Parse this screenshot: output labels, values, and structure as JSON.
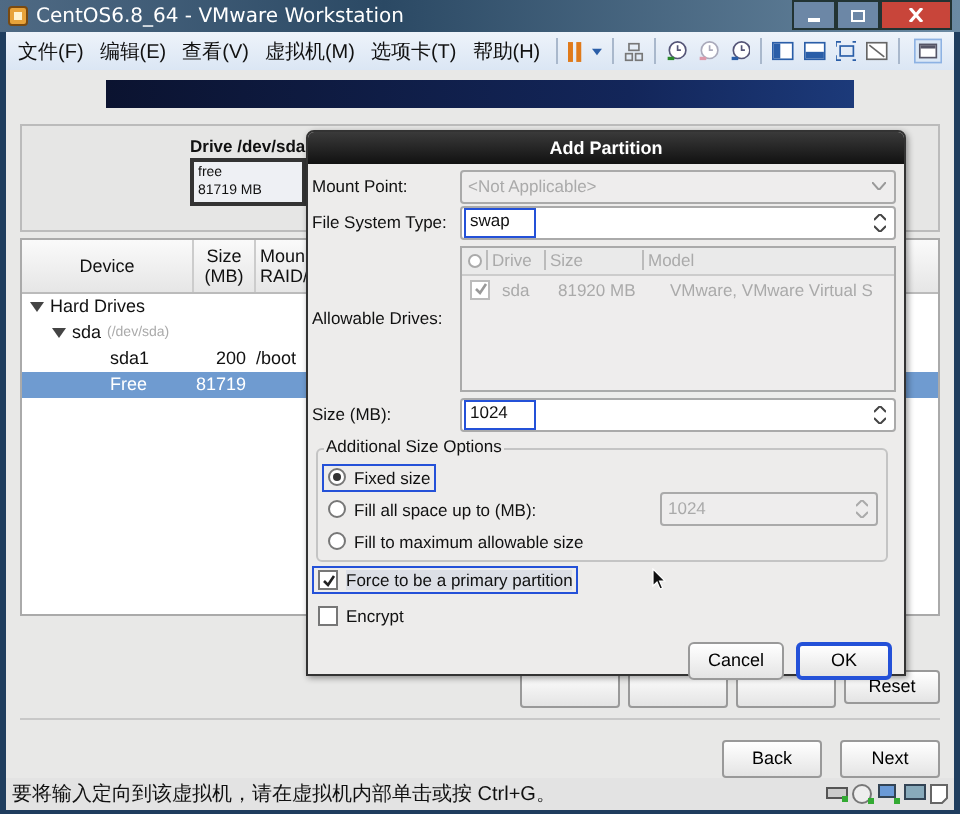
{
  "window": {
    "title": "CentOS6.8_64 - VMware Workstation"
  },
  "menu": [
    "文件(F)",
    "编辑(E)",
    "查看(V)",
    "虚拟机(M)",
    "选项卡(T)",
    "帮助(H)"
  ],
  "drive": {
    "title": "Drive /dev/sda",
    "segment_label": "free",
    "segment_size": "81719 MB"
  },
  "table": {
    "columns": [
      [
        "Device"
      ],
      [
        "Size",
        "(MB)"
      ],
      [
        "Moun",
        "RAID/"
      ]
    ],
    "rows": [
      {
        "device": "Hard Drives",
        "expanded": true,
        "selected": false,
        "children": [
          {
            "device": "sda",
            "note": "(/dev/sda)",
            "expanded": true,
            "selected": false,
            "children": [
              {
                "device": "sda1",
                "size": "200",
                "mount": "/boot",
                "selected": false
              },
              {
                "device": "Free",
                "size": "81719",
                "selected": true
              }
            ]
          }
        ]
      }
    ]
  },
  "background_buttons": [
    {
      "label": "Reset"
    }
  ],
  "dialog": {
    "title": "Add Partition",
    "mount_point": {
      "label": "Mount Point:",
      "value": "<Not Applicable>",
      "disabled": true
    },
    "fs_type": {
      "label": "File System Type:",
      "value": "swap",
      "highlighted": true
    },
    "drives": {
      "label": "Allowable Drives:",
      "columns": [
        "Drive",
        "Size",
        "Model"
      ],
      "rows": [
        {
          "checked": true,
          "drive": "sda",
          "size": "81920 MB",
          "model": "VMware, VMware Virtual S"
        }
      ]
    },
    "size": {
      "label": "Size (MB):",
      "value": "1024",
      "highlighted": true
    },
    "size_options": {
      "title": "Additional Size Options",
      "options": [
        {
          "label": "Fixed size",
          "selected": true,
          "highlighted": true
        },
        {
          "label": "Fill all space up to (MB):",
          "selected": false,
          "highlighted": false,
          "value": "1024"
        },
        {
          "label": "Fill to maximum allowable size",
          "selected": false,
          "highlighted": false
        }
      ]
    },
    "checkboxes": [
      {
        "label": "Force to be a primary partition",
        "checked": true,
        "highlighted": true
      },
      {
        "label": "Encrypt",
        "checked": false,
        "highlighted": false
      }
    ],
    "buttons": [
      {
        "label": "Cancel",
        "highlighted": false
      },
      {
        "label": "OK",
        "highlighted": true
      }
    ]
  },
  "nav_buttons": [
    {
      "label": "Back"
    },
    {
      "label": "Next"
    }
  ],
  "status_bar": {
    "text": "要将输入定向到该虚拟机，请在虚拟机内部单击或按 Ctrl+G。"
  }
}
